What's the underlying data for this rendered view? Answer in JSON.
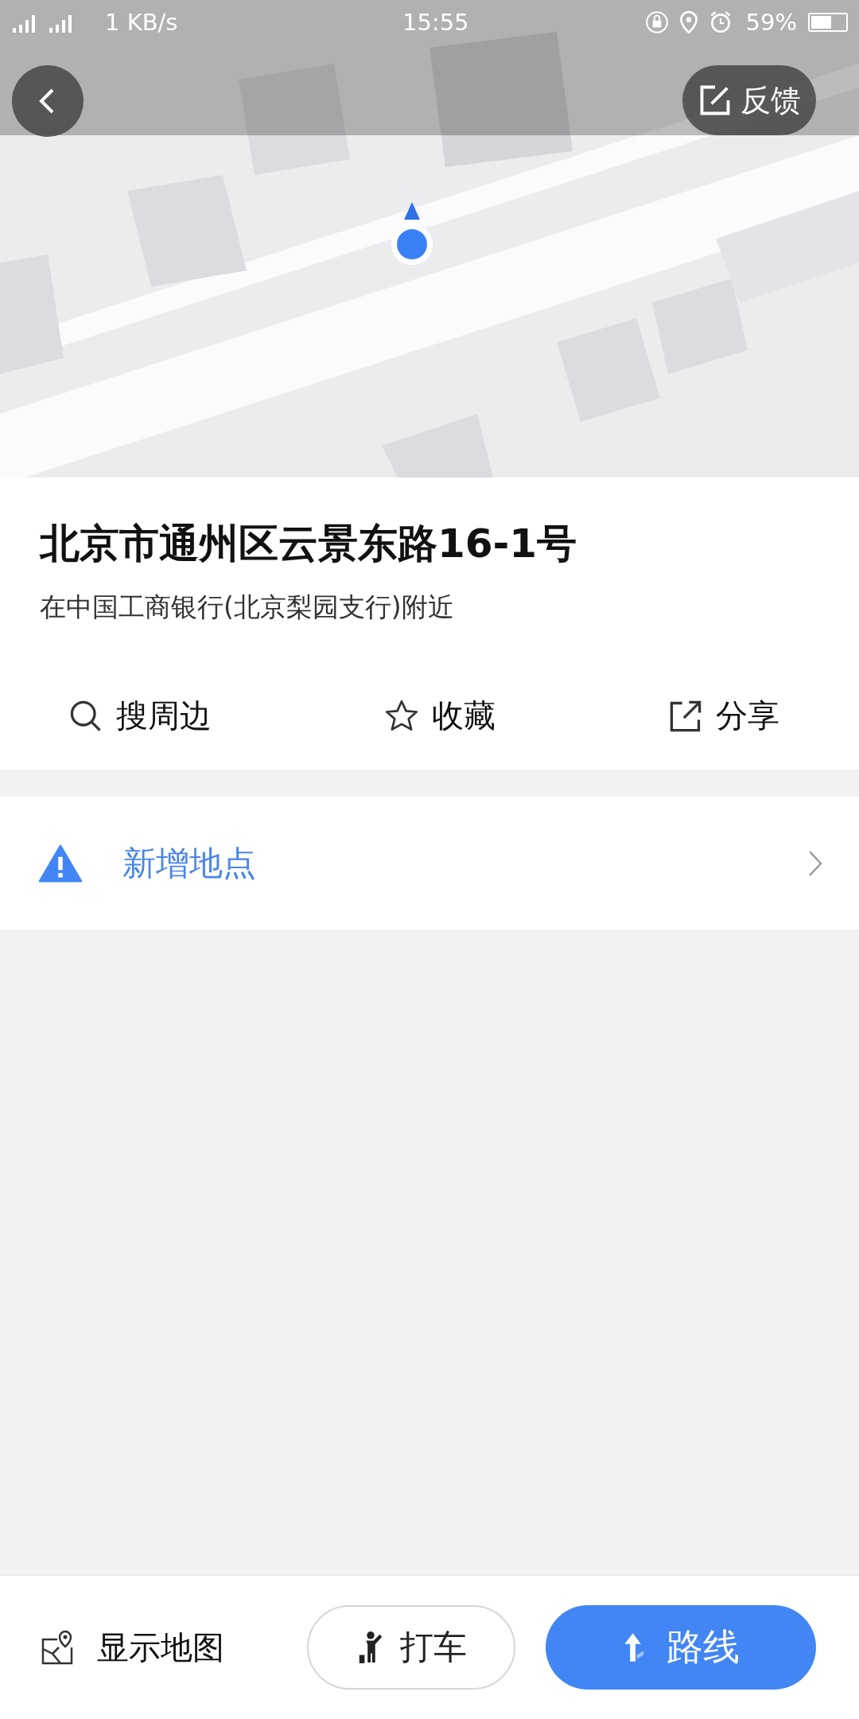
{
  "status_bar": {
    "network": "1 KB/s",
    "time": "15:55",
    "battery": "59%"
  },
  "map": {
    "feedback_button": "反馈"
  },
  "place": {
    "title": "北京市通州区云景东路16-1号",
    "subtitle": "在中国工商银行(北京梨园支行)附近"
  },
  "actions": [
    {
      "kind": "search",
      "label": "搜周边"
    },
    {
      "kind": "star",
      "label": "收藏"
    },
    {
      "kind": "share",
      "label": "分享"
    }
  ],
  "add_place": {
    "label": "新增地点"
  },
  "bottom_bar": {
    "show_map": "显示地图",
    "taxi": "打车",
    "route": "路线"
  }
}
